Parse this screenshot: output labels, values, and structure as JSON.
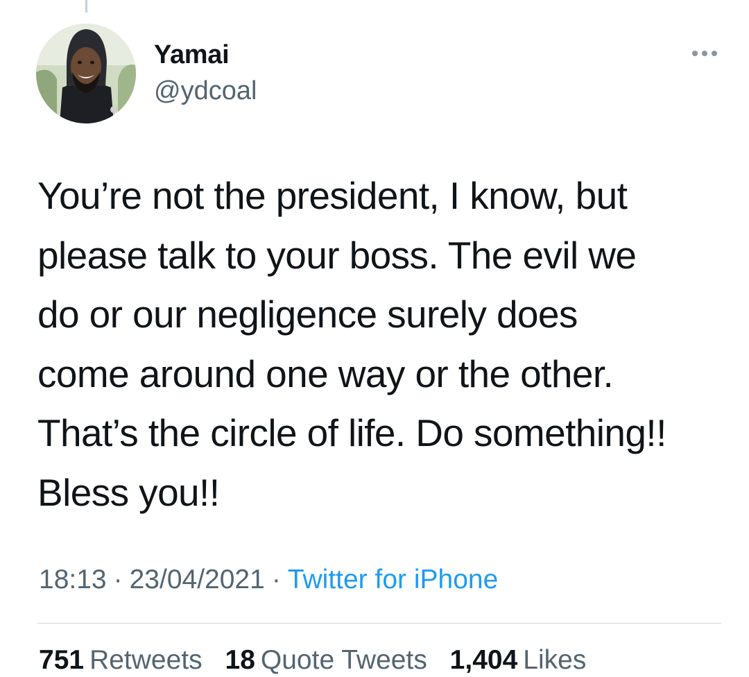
{
  "user": {
    "display_name": "Yamai",
    "handle": "@ydcoal",
    "avatar_icon": "profile-photo"
  },
  "more_icon": "more-horizontal-icon",
  "tweet": {
    "lines": [
      "You’re not the president, I know, but",
      "please talk to your boss. The evil we",
      "do or our negligence surely does",
      "come around one way or the other.",
      "That’s the circle of life. Do something!!",
      "Bless you!!"
    ]
  },
  "meta": {
    "time": "18:13",
    "separator": "·",
    "date": "23/04/2021",
    "source": "Twitter for iPhone"
  },
  "stats": {
    "retweets": {
      "count": "751",
      "label": "Retweets"
    },
    "quote_tweets": {
      "count": "18",
      "label": "Quote Tweets"
    },
    "likes": {
      "count": "1,404",
      "label": "Likes"
    }
  },
  "colors": {
    "text": "#0f1419",
    "secondary": "#536471",
    "link": "#1d9bf0",
    "divider": "#cfd9de"
  }
}
